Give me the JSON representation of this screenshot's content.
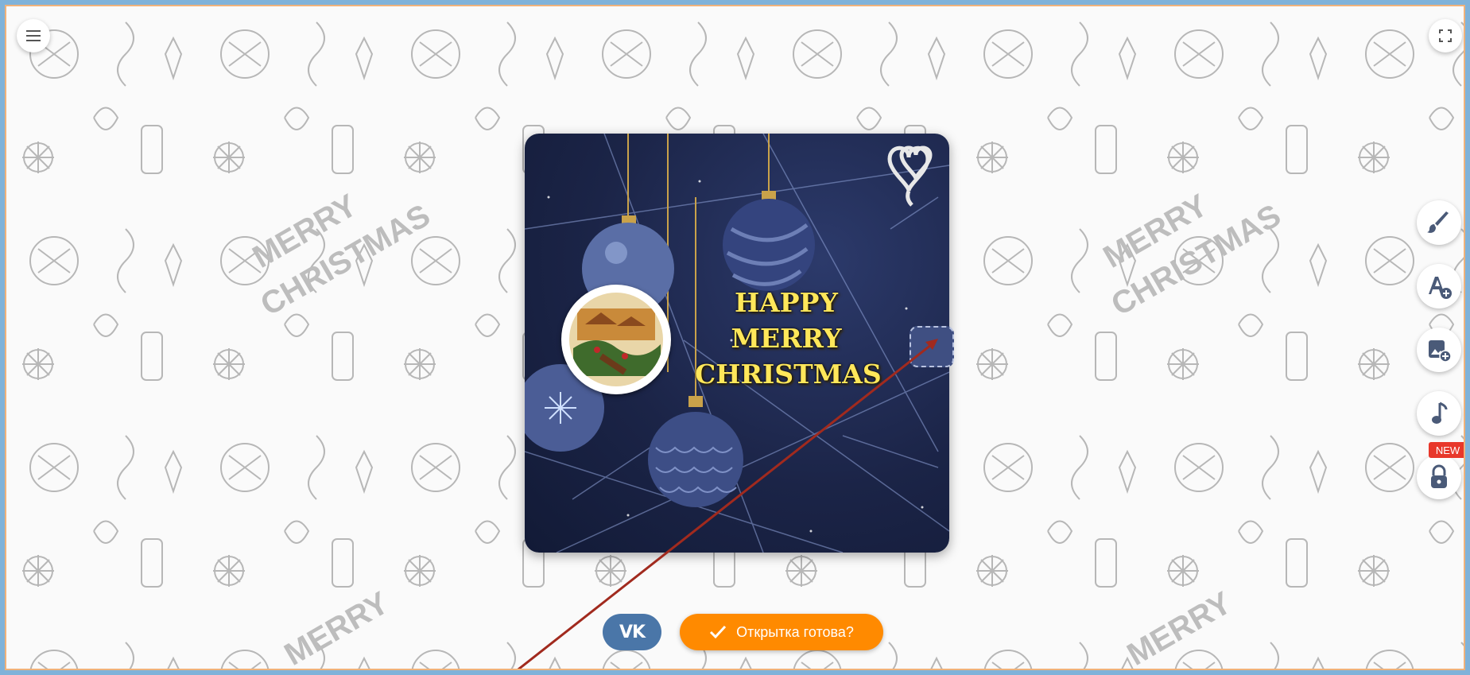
{
  "toolbar": {
    "menu_icon": "hamburger-icon",
    "fullscreen_icon": "fullscreen-icon",
    "tools": [
      {
        "icon": "brush-icon"
      },
      {
        "icon": "add-text-icon"
      },
      {
        "icon": "add-image-icon"
      },
      {
        "icon": "music-note-icon"
      },
      {
        "icon": "lock-icon",
        "badge": "NEW"
      }
    ]
  },
  "card": {
    "greeting_lines": [
      "HAPPY",
      "MERRY",
      "CHRISTMAS"
    ],
    "greeting_color": "#ffe75a",
    "decor_icon": "hearts-balloon-icon"
  },
  "pattern_text": [
    "MERRY",
    "CHRISTMAS"
  ],
  "actions": {
    "vk_label": "VK",
    "done_label": "Открытка готова?",
    "done_color": "#ff8a00",
    "vk_color": "#4a76a8"
  }
}
